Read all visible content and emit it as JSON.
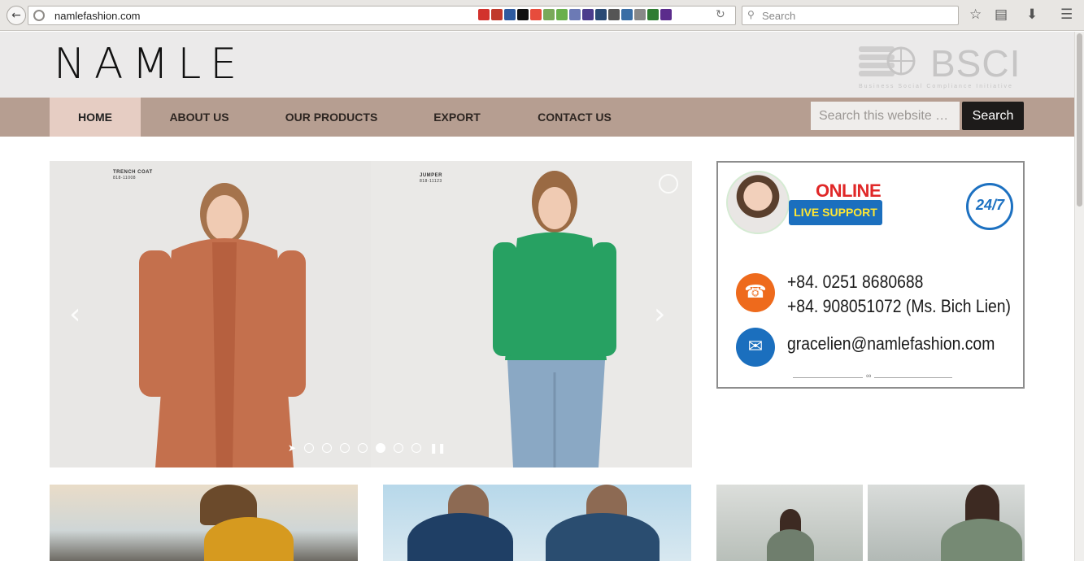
{
  "browser": {
    "url": "namlefashion.com",
    "search_placeholder": "Search"
  },
  "header": {
    "logo": "NAMLE",
    "bsci_logo": "BSCI",
    "bsci_tagline": "Business Social Compliance Initiative"
  },
  "nav": {
    "items": [
      {
        "label": "HOME",
        "active": true
      },
      {
        "label": "ABOUT US",
        "active": false
      },
      {
        "label": "OUR PRODUCTS",
        "active": false
      },
      {
        "label": "EXPORT",
        "active": false
      },
      {
        "label": "CONTACT US",
        "active": false
      }
    ],
    "search_placeholder": "Search this website …",
    "search_button": "Search"
  },
  "slider": {
    "left_tag": "TRENCH COAT",
    "left_code": "818-11008",
    "right_tag": "JUMPER",
    "right_code": "818-11123",
    "dot_count": 7,
    "active_dot": 5
  },
  "support": {
    "online": "ONLINE",
    "live": "LIVE SUPPORT",
    "hours": "24/7",
    "phone1": "+84. 0251 8680688",
    "phone2": "+84. 908051072 (Ms. Bich Lien)",
    "email": "gracelien@namlefashion.com"
  },
  "colors": {
    "nav_bg": "#b69e91",
    "nav_active": "#e6cdc3",
    "header_bg": "#ebeaea",
    "search_button": "#1d1b1a"
  }
}
